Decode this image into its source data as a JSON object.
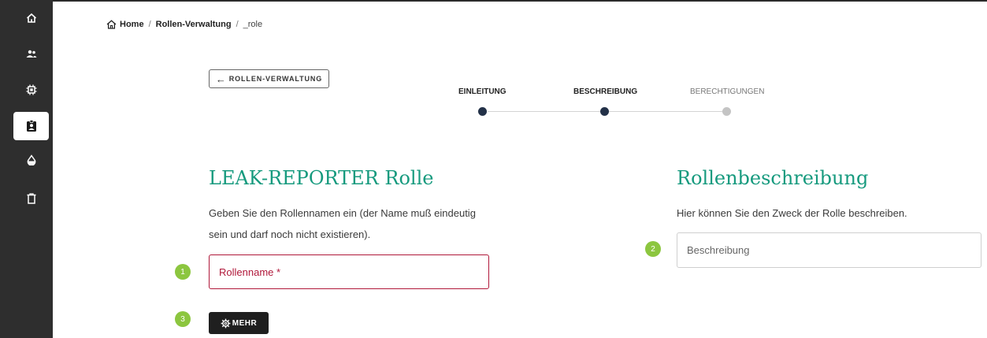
{
  "sidebar": {
    "items": [
      {
        "icon": "home-icon",
        "active": false
      },
      {
        "icon": "users-icon",
        "active": false
      },
      {
        "icon": "chip-icon",
        "active": false
      },
      {
        "icon": "id-badge-icon",
        "active": true
      },
      {
        "icon": "drop-icon",
        "active": false
      },
      {
        "icon": "trash-icon",
        "active": false
      }
    ]
  },
  "breadcrumb": {
    "home_icon": "home-outline-icon",
    "items": [
      "Home",
      "Rollen-Verwaltung",
      "_role"
    ],
    "separator": "/"
  },
  "back_button": {
    "icon": "arrow-left-icon",
    "label": "ROLLEN-VERWALTUNG"
  },
  "stepper": {
    "steps": [
      {
        "label": "EINLEITUNG",
        "state": "done"
      },
      {
        "label": "BESCHREIBUNG",
        "state": "current"
      },
      {
        "label": "BERECHTIGUNGEN",
        "state": "pending"
      }
    ]
  },
  "left_section": {
    "title": "LEAK-REPORTER Rolle",
    "description_line1": "Geben Sie den Rollennamen ein (der Name muß eindeutig",
    "description_line2": "sein und darf noch nicht existieren).",
    "name_field": {
      "placeholder": "Rollenname *",
      "value": ""
    }
  },
  "right_section": {
    "title": "Rollenbeschreibung",
    "description": "Hier können Sie den Zweck der Rolle beschreiben.",
    "description_field": {
      "placeholder": "Beschreibung",
      "value": ""
    }
  },
  "badges": [
    "1",
    "2",
    "3"
  ],
  "more_button": {
    "icon": "gear-icon",
    "label": "MEHR"
  },
  "colors": {
    "accent": "#169a7e",
    "sidebar_bg": "#2e2e2e",
    "error": "#b0183a",
    "badge": "#8cc63f",
    "step_active": "#233148",
    "step_pending": "#c4c4c4"
  }
}
